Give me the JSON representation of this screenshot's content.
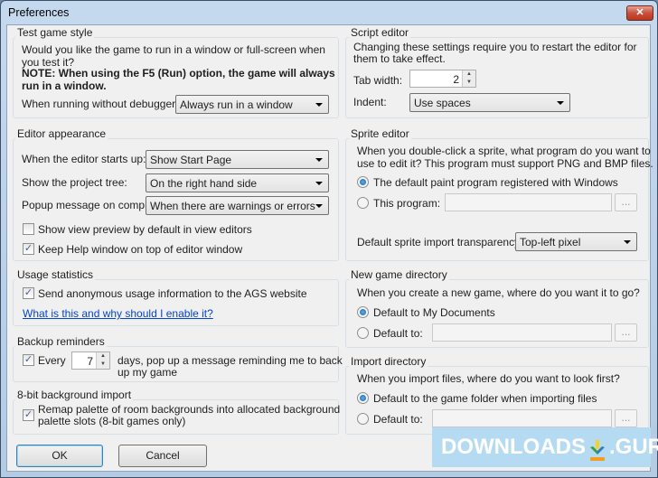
{
  "window": {
    "title": "Preferences",
    "close": "✕"
  },
  "test_game_style": {
    "legend": "Test game style",
    "desc": "Would you like the game to run in a window or full-screen when you test it?",
    "note_line1": "NOTE: When using the F5 (Run) option, the game will always",
    "note_line2": "run in a window.",
    "label": "When running without debugger:",
    "value": "Always run in a window"
  },
  "editor_appearance": {
    "legend": "Editor appearance",
    "starts_label": "When the editor starts up:",
    "starts_value": "Show Start Page",
    "tree_label": "Show the project tree:",
    "tree_value": "On the right hand side",
    "popup_label": "Popup message on compile:",
    "popup_value": "When there are warnings or errors",
    "view_preview": "Show view preview by default in view editors",
    "view_preview_checked": false,
    "keep_help": "Keep Help window on top of editor window",
    "keep_help_checked": true
  },
  "usage": {
    "legend": "Usage statistics",
    "send": "Send anonymous usage information to the AGS website",
    "send_checked": true,
    "link": "What is this and why should I enable it?"
  },
  "backup": {
    "legend": "Backup reminders",
    "every": "Every",
    "every_checked": true,
    "days": "7",
    "text_line1": "days, pop up a message reminding me to back",
    "text_line2": "up my game"
  },
  "bg_import": {
    "legend": "8-bit background import",
    "remap_line1": "Remap palette of room backgrounds into allocated background",
    "remap_line2": "palette slots (8-bit games only)",
    "remap_checked": true
  },
  "script_editor": {
    "legend": "Script editor",
    "desc_line1": "Changing these settings require you to restart the editor for",
    "desc_line2": "them to take effect.",
    "tab_label": "Tab width:",
    "tab_value": "2",
    "indent_label": "Indent:",
    "indent_value": "Use spaces"
  },
  "sprite_editor": {
    "legend": "Sprite editor",
    "desc_line1": "When you double-click a sprite, what program do you want to",
    "desc_line2": "use to edit it? This program must support PNG and BMP files.",
    "opt_default": "The default paint program registered with Windows",
    "opt_program": "This program:",
    "program_value": "",
    "browse": "...",
    "transparency_label": "Default sprite import transparency:",
    "transparency_value": "Top-left pixel"
  },
  "new_game_dir": {
    "legend": "New game directory",
    "desc": "When you create a new game, where do you want it to go?",
    "opt_default": "Default to My Documents",
    "opt_custom": "Default to:",
    "custom_value": "",
    "browse": "..."
  },
  "import_dir": {
    "legend": "Import directory",
    "desc": "When you import files, where do you want to look first?",
    "opt_default": "Default to the game folder when importing files",
    "opt_custom": "Default to:",
    "custom_value": "",
    "browse": "..."
  },
  "buttons": {
    "ok": "OK",
    "cancel": "Cancel"
  },
  "watermark": {
    "left": "DOWNLOADS",
    "right": ".GURU"
  }
}
